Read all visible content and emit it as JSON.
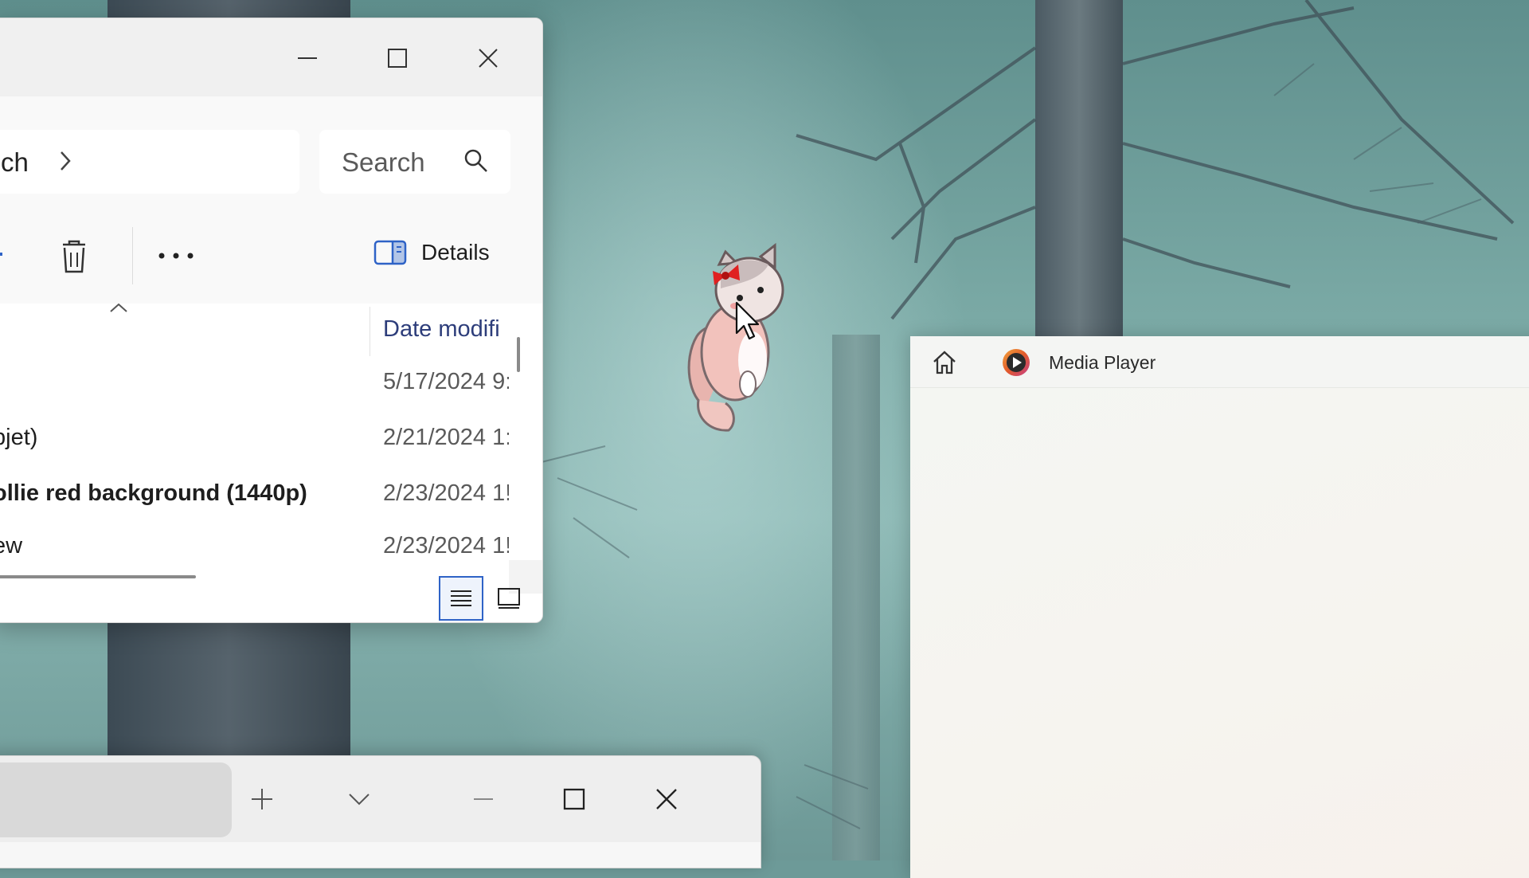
{
  "explorer": {
    "address_text": "ch",
    "search_placeholder": "Search",
    "toolbar": {
      "details_label": "Details"
    },
    "column_header": "Date modifi",
    "rows": [
      {
        "name": "",
        "date": "5/17/2024 9:"
      },
      {
        "name": "bjet)",
        "date": "2/21/2024 1:"
      },
      {
        "name": "ollie red background (1440p)",
        "date": "2/23/2024 1!"
      },
      {
        "name": "ew",
        "date": "2/23/2024 1!"
      }
    ]
  },
  "media_player": {
    "title": "Media Player"
  },
  "colors": {
    "accent": "#2f63c7",
    "media_logo": "#e15a2b"
  }
}
